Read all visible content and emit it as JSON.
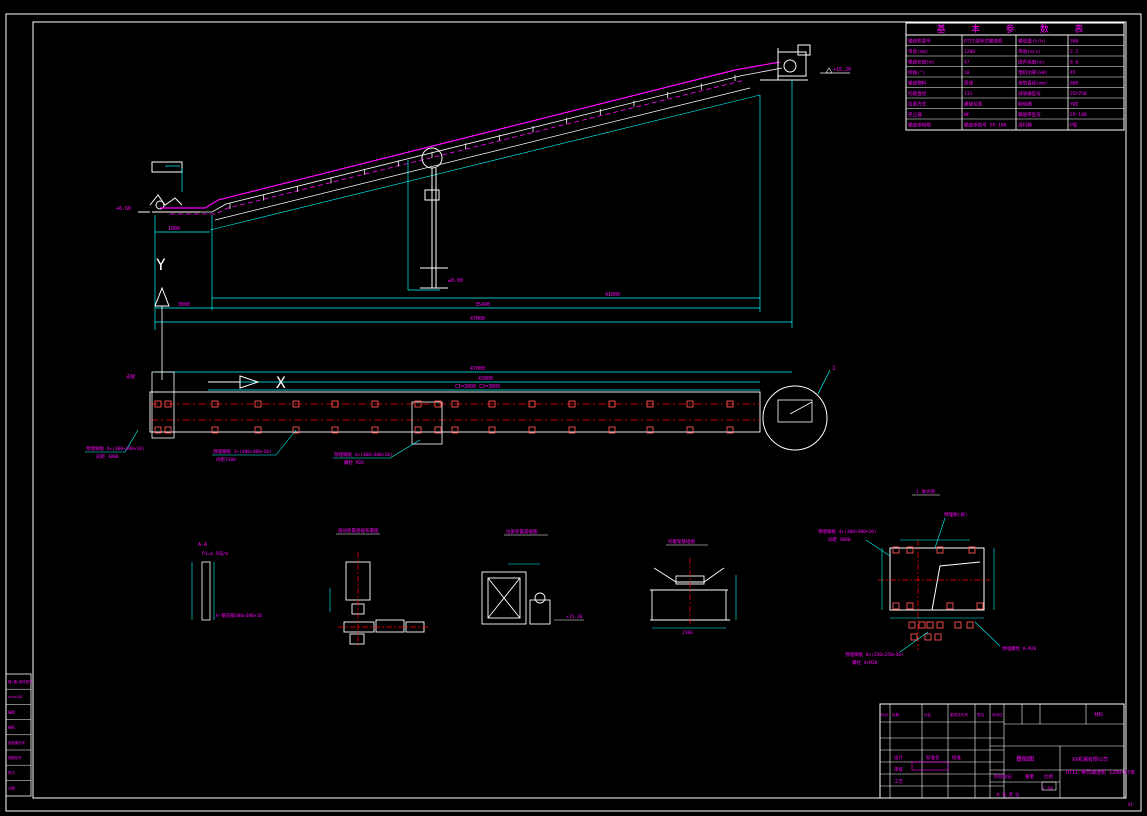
{
  "colors": {
    "background": "#000000",
    "frame": "#ffffff",
    "conveyor": "#ff00ff",
    "dimension": "#00ffff",
    "centerline": "#ff0000",
    "outline": "#ffffff",
    "leader": "#00ffff"
  },
  "param_table": {
    "title": "基 本 参 数 表",
    "rows": [
      [
        "输送机型号",
        "DTII型带式输送机",
        "输送量(t/h)",
        "300"
      ],
      [
        "带宽(mm)",
        "1200",
        "带速(m/s)",
        "2.5"
      ],
      [
        "输送长度(m)",
        "47",
        "提升高度(m)",
        "8.6"
      ],
      [
        "倾角(°)",
        "18",
        "电机功率(kW)",
        "45"
      ],
      [
        "输送物料",
        "原煤",
        "滚筒直径(mm)",
        "800"
      ],
      [
        "托辊直径",
        "133",
        "减速器型号",
        "ZSY250"
      ],
      [
        "拉紧方式",
        "螺旋拉紧",
        "制动器",
        "YWZ"
      ],
      [
        "逆止器",
        "NF",
        "输送带型号",
        "EP-100"
      ],
      [
        "输送带规格",
        "输送带型号 EP-100",
        "清扫器",
        "P型"
      ]
    ]
  },
  "elevation": {
    "dim_total": "47000",
    "dim_horizontal": "41000",
    "dim_head_span": "35490",
    "dim_mid": "3000",
    "dim_left": "1000",
    "level_head": "+15.20",
    "level_tail": "+6.60",
    "level_ground": "±0.00",
    "label_y": "Y",
    "label_x": "X",
    "detail_ref": "1"
  },
  "plan": {
    "dim_total": "47000",
    "dim_span": "43000",
    "dim_segment": "C1=3000 C2=3000",
    "callout_1": "预埋钢板 4×(300×300×10)",
    "callout_1b": "间距 3000",
    "callout_2": "预埋钢板 2×(400×400×10)",
    "callout_2b": "间距1500",
    "callout_3": "预埋钢板 4×(300×300×10)",
    "callout_3b": "螺栓 M20",
    "side_tag": "支腿"
  },
  "sections": {
    "sec_a_title": "A-A",
    "sec_a_note1": "P1=4.5吨/m",
    "sec_a_note2": "H-钢支腿300×300×10",
    "sec_b_title": "驱动装置基础布置图",
    "sec_c_title": "拉紧装置基础图",
    "sec_c_level": "+15.20",
    "sec_d_title": "托辊架基础图",
    "sec_d_dim": "1500",
    "sec_e_title": "I 放大图",
    "sec_e_callout1": "预埋钢板 4×(300×300×10)",
    "sec_e_callout1b": "间距 3000",
    "sec_e_callout2": "预埋板(坡)",
    "sec_e_callout3": "预埋钢板 8×(250×250×10)",
    "sec_e_callout3b": "螺栓 4×M20",
    "sec_e_callout4": "预埋螺栓 8-M20"
  },
  "title_block": {
    "heads": [
      "标记",
      "处数",
      "分区",
      "更改文件号",
      "签名",
      "年月日"
    ],
    "stage_label": "阶段标记",
    "weight_label": "重量",
    "scale_label": "比例",
    "designer": "设计",
    "checker": "审核",
    "standard": "标准化",
    "process": "工艺",
    "approve": "批准",
    "material": "材料",
    "drawing_name": "基础图",
    "company": "XX机械有限公司",
    "drawing_no": "DTII 带式输送机 1200×47米",
    "scale": "1:50",
    "sheet": "共 张 第 张"
  },
  "side_stamp": {
    "rows": [
      "借(通)用件登记",
      "AutoCAD",
      "描图",
      "描校",
      "旧底图总号",
      "底图总号",
      "签字",
      "日期"
    ]
  },
  "corner_mark": "A1"
}
